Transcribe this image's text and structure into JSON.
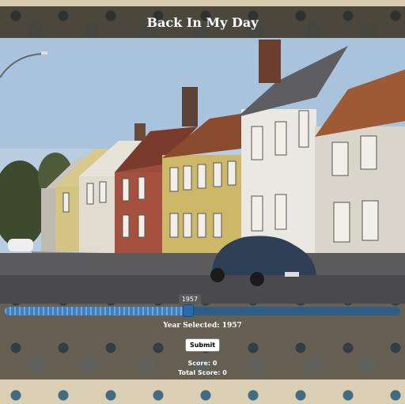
{
  "header": {
    "title": "Back In My Day"
  },
  "photo": {
    "subject": "street-scene-photo"
  },
  "slider": {
    "min": 1900,
    "max": 2023,
    "value": 1957,
    "tooltip": "1957"
  },
  "year_selected": "Year Selected: 1957",
  "submit_label": "Submit",
  "score": "Score: 0",
  "total_score": "Total Score: 0",
  "colors": {
    "slider_track": "#2e5d86",
    "slider_fill": "#3e80c0",
    "header_bg": "#28261e"
  }
}
